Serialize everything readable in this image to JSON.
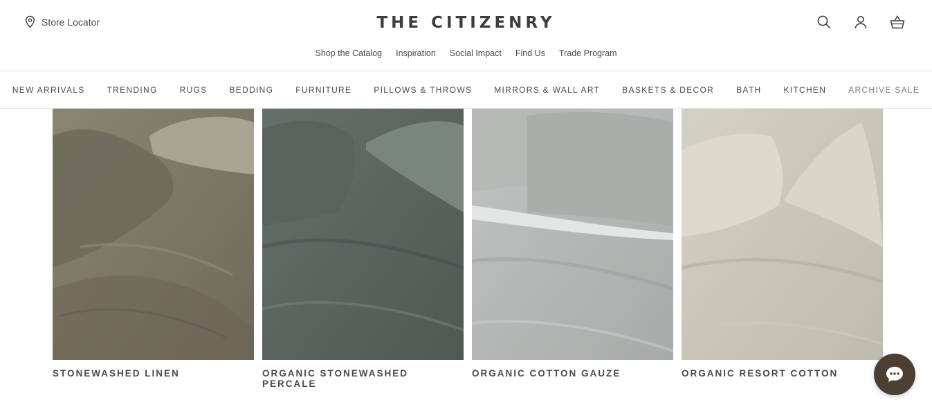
{
  "header": {
    "store_locator": "Store Locator",
    "brand": "THE CITIZENRY",
    "util_links": [
      "Shop the Catalog",
      "Inspiration",
      "Social Impact",
      "Find Us",
      "Trade Program"
    ],
    "icons": [
      "search-icon",
      "account-icon",
      "cart-icon"
    ]
  },
  "nav": {
    "items": [
      "NEW ARRIVALS",
      "TRENDING",
      "RUGS",
      "BEDDING",
      "FURNITURE",
      "PILLOWS & THROWS",
      "MIRRORS & WALL ART",
      "BASKETS & DECOR",
      "BATH",
      "KITCHEN",
      "ARCHIVE SALE"
    ],
    "sale_color": "#8a7868"
  },
  "products": [
    {
      "name": "STONEWASHED LINEN",
      "color": "#7f7868"
    },
    {
      "name": "ORGANIC STONEWASHED PERCALE",
      "color": "#5d6660"
    },
    {
      "name": "ORGANIC COTTON GAUZE",
      "color": "#b3b7b5"
    },
    {
      "name": "ORGANIC RESORT COTTON",
      "color": "#cbc7b9"
    }
  ],
  "chat": {
    "icon": "chat-bubble-icon",
    "color": "#4b3f34"
  }
}
